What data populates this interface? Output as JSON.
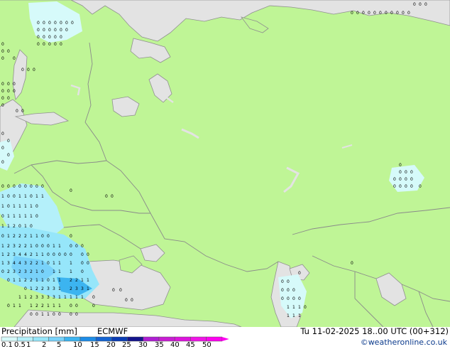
{
  "header": {
    "title": "Precipitation [mm]",
    "model": "ECMWF",
    "datetime": "Tu 11-02-2025 18..00 UTC (00+312)"
  },
  "credit": "©weatheronline.co.uk",
  "colors": {
    "land": "#bff596",
    "water": "#e3e3e3",
    "border": "#8a8a8a",
    "coast": "#909090"
  },
  "legend": {
    "labels": [
      "0.1",
      "0.5",
      "1",
      "2",
      "5",
      "10",
      "15",
      "20",
      "25",
      "30",
      "35",
      "40",
      "45",
      "50"
    ],
    "colors": [
      "#d6fafa",
      "#b4f0fa",
      "#96e6fa",
      "#78d2fa",
      "#3cb4f0",
      "#1e8ce6",
      "#1464d2",
      "#0a3cb4",
      "#14148c",
      "#ae1ed2",
      "#c81ed2",
      "#dc14dc",
      "#f014e6",
      "#ff00f0"
    ]
  }
}
